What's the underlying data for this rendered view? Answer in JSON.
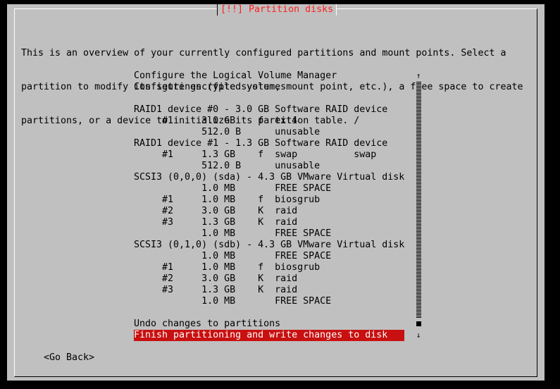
{
  "dialog": {
    "title": "[!!] Partition disks",
    "intro_lines": [
      "This is an overview of your currently configured partitions and mount points. Select a",
      "partition to modify its settings (file system, mount point, etc.), a free space to create",
      "partitions, or a device to initialize its partition table."
    ]
  },
  "list": {
    "rows": [
      {
        "text": "Configure the Logical Volume Manager",
        "selected": false
      },
      {
        "text": "Configure encrypted volumes",
        "selected": false
      },
      {
        "text": "",
        "selected": false
      },
      {
        "text": "RAID1 device #0 - 3.0 GB Software RAID device",
        "selected": false
      },
      {
        "text": "     #1     3.0 GB    f  ext4          /",
        "selected": false
      },
      {
        "text": "            512.0 B      unusable",
        "selected": false
      },
      {
        "text": "RAID1 device #1 - 1.3 GB Software RAID device",
        "selected": false
      },
      {
        "text": "     #1     1.3 GB    f  swap          swap",
        "selected": false
      },
      {
        "text": "            512.0 B      unusable",
        "selected": false
      },
      {
        "text": "SCSI3 (0,0,0) (sda) - 4.3 GB VMware Virtual disk",
        "selected": false
      },
      {
        "text": "            1.0 MB       FREE SPACE",
        "selected": false
      },
      {
        "text": "     #1     1.0 MB    f  biosgrub",
        "selected": false
      },
      {
        "text": "     #2     3.0 GB    K  raid",
        "selected": false
      },
      {
        "text": "     #3     1.3 GB    K  raid",
        "selected": false
      },
      {
        "text": "            1.0 MB       FREE SPACE",
        "selected": false
      },
      {
        "text": "SCSI3 (0,1,0) (sdb) - 4.3 GB VMware Virtual disk",
        "selected": false
      },
      {
        "text": "            1.0 MB       FREE SPACE",
        "selected": false
      },
      {
        "text": "     #1     1.0 MB    f  biosgrub",
        "selected": false
      },
      {
        "text": "     #2     3.0 GB    K  raid",
        "selected": false
      },
      {
        "text": "     #3     1.3 GB    K  raid",
        "selected": false
      },
      {
        "text": "            1.0 MB       FREE SPACE",
        "selected": false
      },
      {
        "text": "",
        "selected": false
      },
      {
        "text": "Undo changes to partitions",
        "selected": false
      },
      {
        "text": "Finish partitioning and write changes to disk",
        "selected": true
      }
    ]
  },
  "scrollbar": {
    "up_arrow_icon": "arrow-up-icon",
    "down_arrow_icon": "arrow-down-icon",
    "up_glyph": "↑",
    "down_glyph": "↓"
  },
  "buttons": {
    "go_back_label": "<Go Back>"
  },
  "colors": {
    "background": "#000000",
    "dialog": "#c0c0c0",
    "title_text": "#ff2020",
    "selection": "#c81010",
    "selection_text": "#ffffff"
  }
}
